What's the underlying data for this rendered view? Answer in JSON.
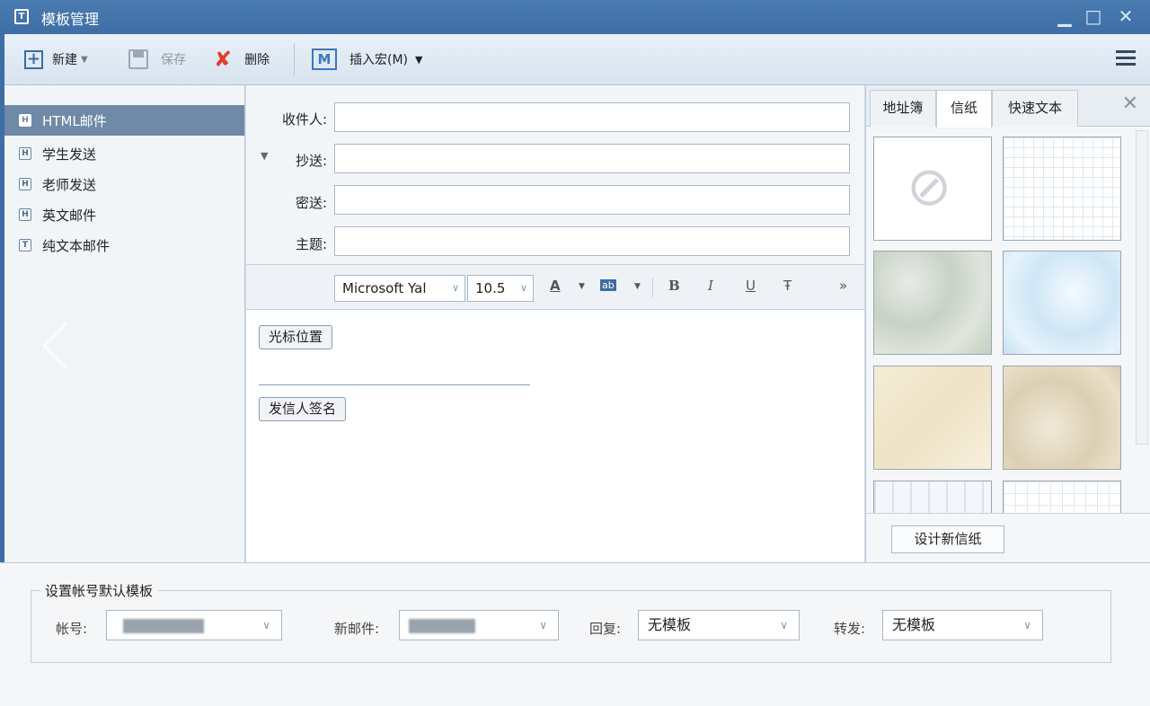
{
  "window": {
    "title": "模板管理",
    "minimize": "▁",
    "maximize": "□",
    "close": "✕"
  },
  "toolbar": {
    "new_label": "新建",
    "save_label": "保存",
    "delete_label": "删除",
    "macro_label": "插入宏(M)",
    "macro_icon": "M"
  },
  "templates": [
    {
      "label": "HTML邮件",
      "type": "H",
      "active": true
    },
    {
      "label": "学生发送",
      "type": "H",
      "active": false
    },
    {
      "label": "老师发送",
      "type": "H",
      "active": false
    },
    {
      "label": "英文邮件",
      "type": "H",
      "active": false
    },
    {
      "label": "纯文本邮件",
      "type": "T",
      "active": false
    }
  ],
  "fields": {
    "to_label": "收件人:",
    "cc_label": "抄送:",
    "bcc_label": "密送:",
    "subject_label": "主题:",
    "cc_toggle": "▼"
  },
  "format": {
    "font": "Microsoft Yal",
    "size": "10.5",
    "color": "A",
    "highlight": "ab",
    "bold": "B",
    "italic": "I",
    "underline": "U",
    "strike": "Ŧ",
    "more": "»"
  },
  "editor": {
    "cursor_tag": "光标位置",
    "signature_tag": "发信人签名"
  },
  "right": {
    "tabs": [
      "地址簿",
      "信纸",
      "快速文本"
    ],
    "active_tab": "信纸",
    "close": "✕",
    "design_button": "设计新信纸",
    "none_symbol": "⊘"
  },
  "defaults": {
    "group_title": "设置帐号默认模板",
    "account_label": "帐号:",
    "new_mail_label": "新邮件:",
    "reply_label": "回复:",
    "reply_value": "无模板",
    "forward_label": "转发:",
    "forward_value": "无模板"
  },
  "colors": {
    "titlebar": "#3d6ea5",
    "active_item": "#6f8aa6",
    "delete_red": "#e0402a"
  }
}
